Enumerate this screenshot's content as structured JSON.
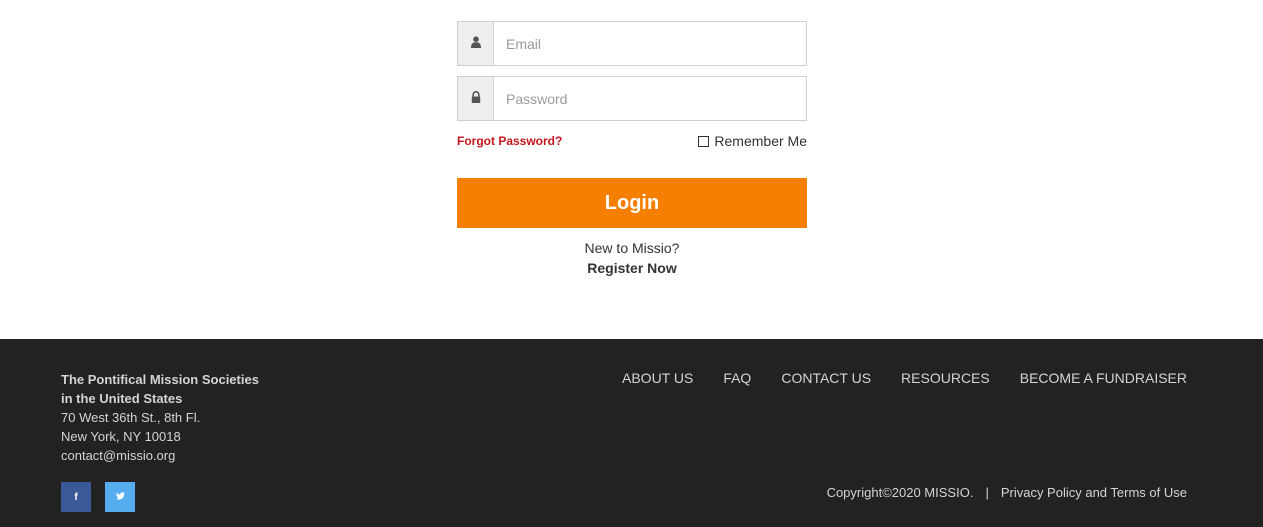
{
  "login": {
    "email_placeholder": "Email",
    "password_placeholder": "Password",
    "forgot_password": "Forgot Password?",
    "remember_me": "Remember Me",
    "remember_checked": false,
    "login_button": "Login",
    "new_to": "New to Missio?",
    "register": "Register Now",
    "icons": {
      "email": "user-icon",
      "password": "lock-icon"
    },
    "colors": {
      "accent": "#f77f00",
      "forgot_link": "#c4161c"
    }
  },
  "footer": {
    "org_name_line1": "The Pontifical Mission Societies",
    "org_name_line2": "in the United States",
    "address_line1": "70 West 36th St., 8th Fl.",
    "address_line2": "New York, NY 10018",
    "email": "contact@missio.org",
    "nav": [
      "ABOUT US",
      "FAQ",
      "CONTACT US",
      "RESOURCES",
      "BECOME A FUNDRAISER"
    ],
    "social": {
      "facebook": "f",
      "twitter": "twitter-icon"
    },
    "copyright": "Copyright©2020 MISSIO.",
    "separator": "|",
    "privacy": "Privacy Policy and Terms of Use",
    "colors": {
      "background": "#222222",
      "facebook": "#3b5998",
      "twitter": "#55acee"
    }
  }
}
